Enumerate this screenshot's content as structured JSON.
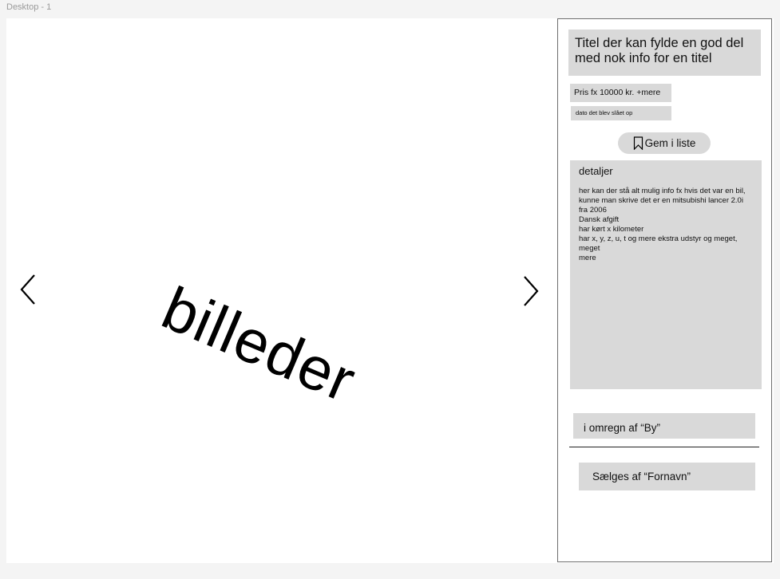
{
  "frame": {
    "label": "Desktop - 1"
  },
  "gallery": {
    "placeholder_text": "billeder",
    "prev_icon": "chevron-left-icon",
    "next_icon": "chevron-right-icon"
  },
  "listing": {
    "title": "Titel der kan fylde en god del med nok info for en titel",
    "price": "Pris fx 10000 kr. +mere",
    "date": "dato det blev slået op",
    "save_button": {
      "label": "Gem i liste",
      "icon": "bookmark-icon"
    },
    "details": {
      "heading": "detaljer",
      "lines": [
        "her kan der stå alt mulig info fx hvis det var en bil, kunne man skrive det er en mitsubishi lancer 2.0i fra 2006",
        "Dansk afgift",
        "har kørt x kilometer",
        "har x, y, z, u, t og mere ekstra udstyr og meget,",
        "meget",
        "mere"
      ]
    },
    "location": "i omregn af “By”",
    "seller": "Sælges af “Fornavn”"
  },
  "colors": {
    "canvas": "#ffffff",
    "background": "#f4f4f4",
    "box_fill": "#d9d9d9",
    "panel_border": "#6e6e6e"
  }
}
